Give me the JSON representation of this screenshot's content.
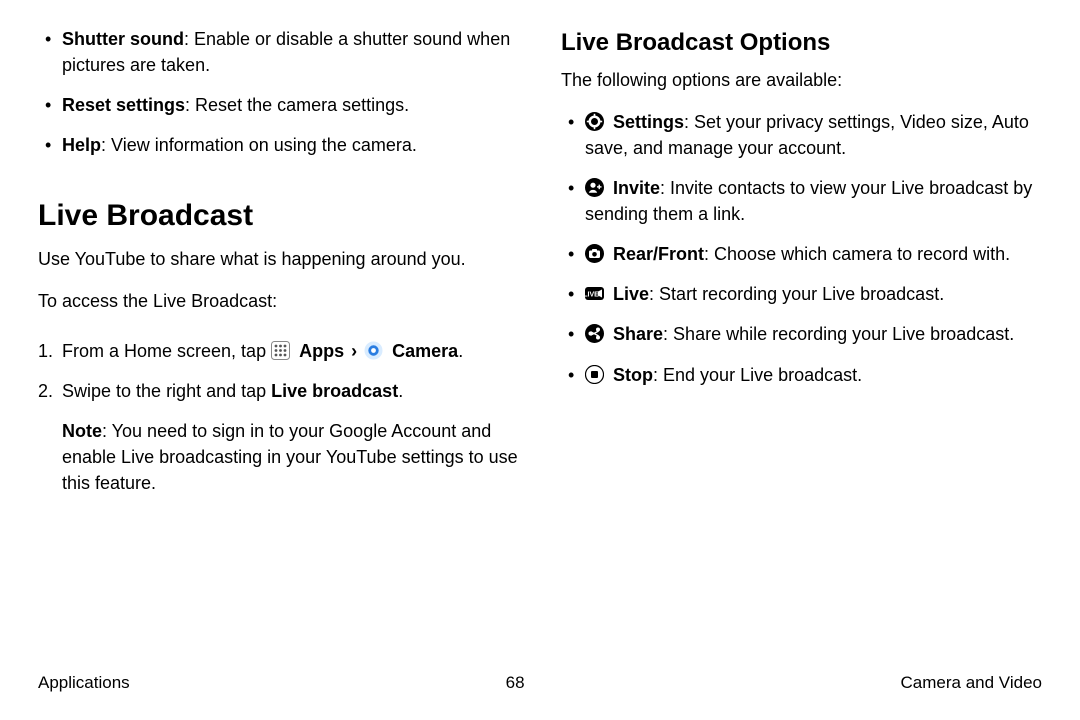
{
  "left": {
    "top_bullets": [
      {
        "label": "Shutter sound",
        "text": ": Enable or disable a shutter sound when pictures are taken."
      },
      {
        "label": "Reset settings",
        "text": ": Reset the camera settings."
      },
      {
        "label": "Help",
        "text": ": View information on using the camera."
      }
    ],
    "heading": "Live Broadcast",
    "intro": "Use YouTube to share what is happening around you.",
    "access_lead": "To access the Live Broadcast:",
    "steps": {
      "s1_num": "1.",
      "s1_pre": "From a Home screen, tap ",
      "s1_apps": "Apps",
      "s1_camera": "Camera",
      "s1_end": ".",
      "s2_num": "2.",
      "s2_pre": "Swipe to the right and tap ",
      "s2_bold": "Live broadcast",
      "s2_end": "."
    },
    "note_label": "Note",
    "note_text": ": You need to sign in to your Google Account and enable Live broadcasting in your YouTube settings to use this feature."
  },
  "right": {
    "heading": "Live Broadcast Options",
    "intro": "The following options are available:",
    "items": [
      {
        "label": "Settings",
        "text": ": Set your privacy settings, Video size, Auto save, and manage your account."
      },
      {
        "label": "Invite",
        "text": ": Invite contacts to view your Live broadcast by sending them a link."
      },
      {
        "label": "Rear/Front",
        "text": ": Choose which camera to record with."
      },
      {
        "label": "Live",
        "text": ": Start recording your Live broadcast."
      },
      {
        "label": "Share",
        "text": ": Share while recording your Live broadcast."
      },
      {
        "label": "Stop",
        "text": ": End your Live broadcast."
      }
    ]
  },
  "footer": {
    "left": "Applications",
    "center": "68",
    "right": "Camera and Video"
  }
}
